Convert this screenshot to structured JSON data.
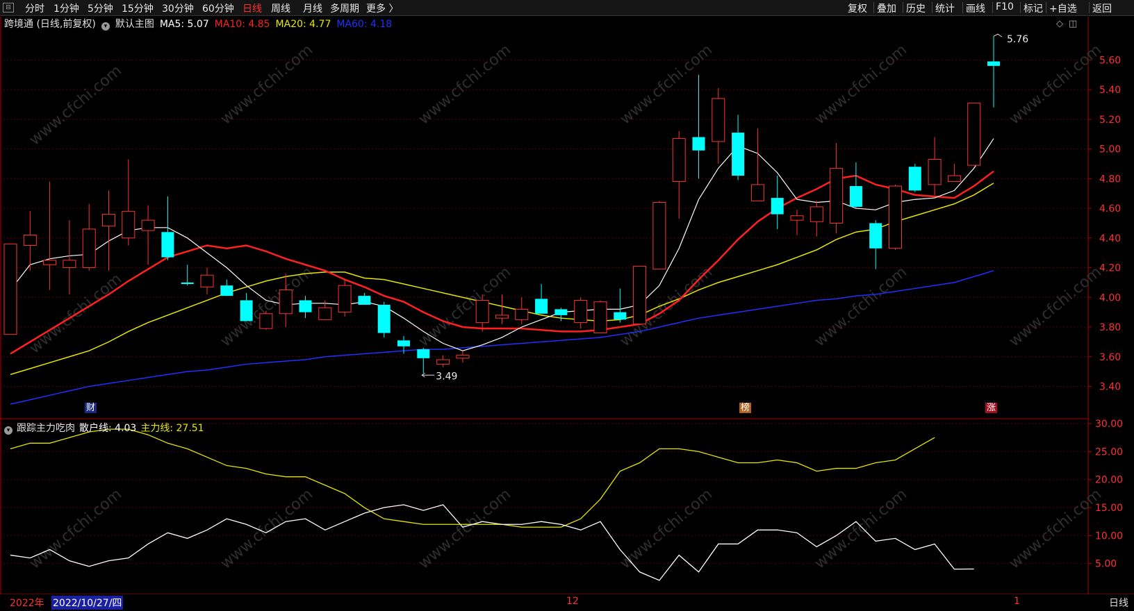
{
  "toolbar": {
    "left_items": [
      "分时",
      "1分钟",
      "5分钟",
      "15分钟",
      "30分钟",
      "60分钟",
      "日线",
      "周线",
      "月线",
      "多周期",
      "更多 〉"
    ],
    "active_index": 6,
    "right_items": [
      "复权",
      "叠加",
      "历史",
      "统计",
      "画线",
      "F10",
      "标记",
      "+自选",
      "返回"
    ]
  },
  "main_info": {
    "title": "跨境通 (日线,前复权)",
    "template": "默认主图",
    "ma5": "MA5: 5.07",
    "ma10": "MA10: 4.85",
    "ma20": "MA20: 4.77",
    "ma60": "MA60: 4.18",
    "colors": {
      "ma5": "#ffffff",
      "ma10": "#ff2020",
      "ma20": "#e6e600",
      "ma60": "#2030ff"
    }
  },
  "indicator_info": {
    "name": "跟踪主力吃肉",
    "retail": "散户线: 4.03",
    "main": "主力线: 27.51",
    "colors": {
      "retail": "#ffffff",
      "main": "#e6e600"
    }
  },
  "price_axis_labels": [
    "5.60",
    "5.40",
    "5.20",
    "5.00",
    "4.80",
    "4.60",
    "4.40",
    "4.20",
    "4.00",
    "3.80",
    "3.60",
    "3.40"
  ],
  "indicator_axis_labels": [
    "30.00",
    "25.00",
    "20.00",
    "15.00",
    "10.00",
    "5.00"
  ],
  "annotations": {
    "high": "5.76",
    "low": "3.49"
  },
  "badges": {
    "cai": "财",
    "bang": "榜",
    "zhang": "涨"
  },
  "bottom": {
    "year": "2022年",
    "cursor_date": "2022/10/27/四",
    "month_12": "12",
    "month_1": "1",
    "period": "日线"
  },
  "watermark": "www.cfchi.com",
  "chart_data": {
    "type": "candlestick",
    "candles": [
      {
        "o": 3.75,
        "h": 4.36,
        "l": 3.75,
        "c": 4.36
      },
      {
        "o": 4.35,
        "h": 4.58,
        "l": 4.18,
        "c": 4.42
      },
      {
        "o": 4.22,
        "h": 4.78,
        "l": 4.05,
        "c": 4.25
      },
      {
        "o": 4.2,
        "h": 4.52,
        "l": 4.02,
        "c": 4.25
      },
      {
        "o": 4.2,
        "h": 4.63,
        "l": 4.18,
        "c": 4.46
      },
      {
        "o": 4.48,
        "h": 4.72,
        "l": 4.18,
        "c": 4.56
      },
      {
        "o": 4.4,
        "h": 4.93,
        "l": 4.35,
        "c": 4.58
      },
      {
        "o": 4.45,
        "h": 4.62,
        "l": 4.22,
        "c": 4.52
      },
      {
        "o": 4.44,
        "h": 4.68,
        "l": 4.25,
        "c": 4.27
      },
      {
        "o": 4.1,
        "h": 4.22,
        "l": 4.08,
        "c": 4.09
      },
      {
        "o": 4.07,
        "h": 4.2,
        "l": 4.02,
        "c": 4.15
      },
      {
        "o": 4.08,
        "h": 4.12,
        "l": 4.03,
        "c": 4.01
      },
      {
        "o": 3.98,
        "h": 4.03,
        "l": 3.84,
        "c": 3.84
      },
      {
        "o": 3.79,
        "h": 3.91,
        "l": 3.78,
        "c": 3.89
      },
      {
        "o": 3.89,
        "h": 4.16,
        "l": 3.8,
        "c": 4.05
      },
      {
        "o": 3.98,
        "h": 4.01,
        "l": 3.86,
        "c": 3.9
      },
      {
        "o": 3.85,
        "h": 3.98,
        "l": 3.85,
        "c": 3.93
      },
      {
        "o": 3.9,
        "h": 4.12,
        "l": 3.87,
        "c": 4.08
      },
      {
        "o": 4.01,
        "h": 4.03,
        "l": 3.95,
        "c": 3.95
      },
      {
        "o": 3.95,
        "h": 3.97,
        "l": 3.73,
        "c": 3.76
      },
      {
        "o": 3.71,
        "h": 3.74,
        "l": 3.62,
        "c": 3.67
      },
      {
        "o": 3.65,
        "h": 3.66,
        "l": 3.49,
        "c": 3.59
      },
      {
        "o": 3.55,
        "h": 3.61,
        "l": 3.53,
        "c": 3.58
      },
      {
        "o": 3.59,
        "h": 3.64,
        "l": 3.56,
        "c": 3.61
      },
      {
        "o": 3.83,
        "h": 4.02,
        "l": 3.77,
        "c": 3.98
      },
      {
        "o": 3.86,
        "h": 4.02,
        "l": 3.82,
        "c": 3.88
      },
      {
        "o": 3.85,
        "h": 4.0,
        "l": 3.82,
        "c": 3.92
      },
      {
        "o": 3.99,
        "h": 4.09,
        "l": 3.9,
        "c": 3.89
      },
      {
        "o": 3.92,
        "h": 3.93,
        "l": 3.84,
        "c": 3.88
      },
      {
        "o": 3.83,
        "h": 4.0,
        "l": 3.79,
        "c": 3.98
      },
      {
        "o": 3.76,
        "h": 3.98,
        "l": 3.76,
        "c": 3.97
      },
      {
        "o": 3.9,
        "h": 4.06,
        "l": 3.83,
        "c": 3.85
      },
      {
        "o": 3.82,
        "h": 4.2,
        "l": 3.82,
        "c": 4.21
      },
      {
        "o": 4.19,
        "h": 4.65,
        "l": 4.19,
        "c": 4.64
      },
      {
        "o": 4.78,
        "h": 5.12,
        "l": 4.53,
        "c": 5.07
      },
      {
        "o": 5.08,
        "h": 5.5,
        "l": 4.8,
        "c": 4.99
      },
      {
        "o": 5.05,
        "h": 5.41,
        "l": 4.9,
        "c": 5.34
      },
      {
        "o": 5.11,
        "h": 5.23,
        "l": 4.79,
        "c": 4.82
      },
      {
        "o": 4.65,
        "h": 5.14,
        "l": 4.66,
        "c": 4.76
      },
      {
        "o": 4.67,
        "h": 4.82,
        "l": 4.46,
        "c": 4.56
      },
      {
        "o": 4.52,
        "h": 4.59,
        "l": 4.42,
        "c": 4.55
      },
      {
        "o": 4.51,
        "h": 4.65,
        "l": 4.41,
        "c": 4.61
      },
      {
        "o": 4.5,
        "h": 5.04,
        "l": 4.43,
        "c": 4.87
      },
      {
        "o": 4.75,
        "h": 4.91,
        "l": 4.6,
        "c": 4.61
      },
      {
        "o": 4.5,
        "h": 4.52,
        "l": 4.19,
        "c": 4.33
      },
      {
        "o": 4.33,
        "h": 4.76,
        "l": 4.32,
        "c": 4.75
      },
      {
        "o": 4.88,
        "h": 4.9,
        "l": 4.71,
        "c": 4.72
      },
      {
        "o": 4.76,
        "h": 5.08,
        "l": 4.69,
        "c": 4.93
      },
      {
        "o": 4.78,
        "h": 4.9,
        "l": 4.78,
        "c": 4.82
      },
      {
        "o": 4.89,
        "h": 5.31,
        "l": 4.89,
        "c": 5.31
      },
      {
        "o": 5.59,
        "h": 5.76,
        "l": 5.28,
        "c": 5.56
      }
    ],
    "ma5": [
      4.05,
      4.22,
      4.26,
      4.28,
      4.29,
      4.38,
      4.45,
      4.47,
      4.47,
      4.4,
      4.3,
      4.2,
      4.08,
      3.98,
      3.95,
      3.96,
      3.96,
      3.95,
      3.97,
      3.94,
      3.86,
      3.77,
      3.69,
      3.64,
      3.68,
      3.73,
      3.8,
      3.85,
      3.9,
      3.91,
      3.92,
      3.92,
      3.95,
      4.08,
      4.33,
      4.66,
      4.87,
      5.02,
      4.97,
      4.84,
      4.66,
      4.64,
      4.65,
      4.6,
      4.59,
      4.64,
      4.66,
      4.67,
      4.72,
      4.87,
      5.07
    ],
    "ma10": [
      3.62,
      3.7,
      3.78,
      3.86,
      3.94,
      4.02,
      4.11,
      4.19,
      4.27,
      4.31,
      4.35,
      4.33,
      4.35,
      4.31,
      4.26,
      4.22,
      4.18,
      4.12,
      4.07,
      4.01,
      3.97,
      3.9,
      3.84,
      3.8,
      3.79,
      3.79,
      3.79,
      3.78,
      3.77,
      3.77,
      3.78,
      3.8,
      3.82,
      3.89,
      3.98,
      4.12,
      4.25,
      4.39,
      4.51,
      4.6,
      4.67,
      4.73,
      4.8,
      4.82,
      4.76,
      4.73,
      4.69,
      4.68,
      4.67,
      4.75,
      4.85
    ],
    "ma20": [
      3.48,
      3.52,
      3.56,
      3.6,
      3.64,
      3.7,
      3.77,
      3.83,
      3.88,
      3.93,
      3.98,
      4.03,
      4.07,
      4.11,
      4.14,
      4.16,
      4.17,
      4.17,
      4.13,
      4.12,
      4.09,
      4.06,
      4.03,
      4.0,
      3.97,
      3.94,
      3.91,
      3.88,
      3.86,
      3.85,
      3.84,
      3.85,
      3.88,
      3.94,
      3.99,
      4.05,
      4.1,
      4.14,
      4.18,
      4.22,
      4.27,
      4.32,
      4.39,
      4.44,
      4.46,
      4.51,
      4.55,
      4.59,
      4.63,
      4.69,
      4.77
    ],
    "ma60": [
      3.28,
      3.31,
      3.34,
      3.37,
      3.4,
      3.42,
      3.44,
      3.46,
      3.48,
      3.5,
      3.51,
      3.53,
      3.55,
      3.56,
      3.57,
      3.58,
      3.6,
      3.61,
      3.62,
      3.63,
      3.64,
      3.65,
      3.65,
      3.66,
      3.67,
      3.68,
      3.69,
      3.7,
      3.71,
      3.72,
      3.73,
      3.75,
      3.77,
      3.8,
      3.83,
      3.86,
      3.88,
      3.9,
      3.92,
      3.94,
      3.96,
      3.98,
      3.99,
      4.01,
      4.02,
      4.04,
      4.06,
      4.08,
      4.1,
      4.14,
      4.18
    ],
    "indicator": {
      "retail": [
        6.5,
        6.0,
        7.5,
        5.5,
        4.5,
        5.5,
        6.0,
        8.5,
        10.5,
        9.5,
        11.0,
        13.0,
        12.0,
        10.5,
        12.5,
        13.0,
        11.0,
        12.5,
        14.0,
        15.0,
        15.5,
        14.5,
        15.5,
        11.5,
        12.5,
        12.0,
        12.0,
        12.5,
        12.0,
        11.0,
        12.5,
        7.5,
        3.5,
        2.0,
        6.5,
        3.5,
        8.5,
        8.5,
        11.0,
        11.0,
        10.5,
        8.0,
        10.0,
        12.5,
        9.0,
        9.5,
        7.5,
        8.5,
        4.0,
        4.03
      ],
      "main": [
        25.5,
        26.5,
        26.5,
        27.5,
        28.5,
        29.0,
        29.0,
        28.0,
        26.5,
        25.5,
        24.0,
        22.5,
        22.0,
        21.0,
        20.5,
        20.5,
        19.0,
        17.5,
        15.0,
        13.0,
        12.5,
        12.0,
        12.0,
        12.0,
        12.0,
        12.0,
        11.5,
        11.5,
        11.5,
        13.0,
        16.5,
        21.5,
        23.0,
        25.5,
        25.5,
        25.0,
        24.0,
        23.0,
        23.0,
        23.5,
        23.0,
        21.5,
        22.0,
        22.0,
        23.0,
        23.5,
        25.5,
        27.51
      ],
      "ylim": [
        0,
        31
      ]
    },
    "ylim": [
      3.29,
      5.77
    ]
  }
}
